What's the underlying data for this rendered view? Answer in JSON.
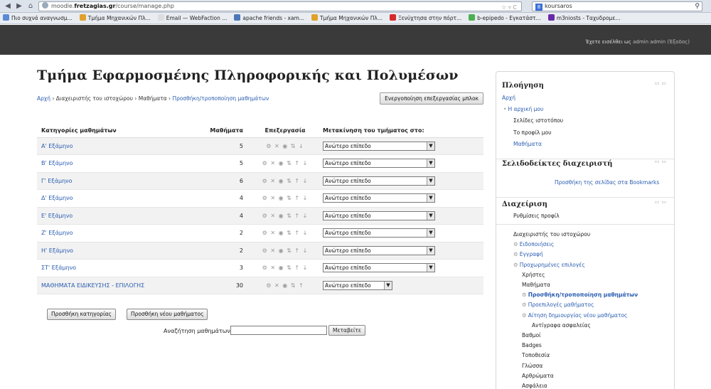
{
  "browser": {
    "url_host": "moodle.",
    "url_host_bold": "fretzagias.gr",
    "url_path": "/course/manage.php",
    "url_right": "☆ ▿ C",
    "search_value": "koursaros",
    "bookmarks": [
      {
        "label": "Πιο συχνά αναγνωσμ...",
        "color": "#5b8ad6"
      },
      {
        "label": "Τμήμα Μηχανικών Πλ...",
        "color": "#e0a12b"
      },
      {
        "label": "Email — WebFaction ...",
        "color": "#dddddd"
      },
      {
        "label": "apache friends - xam...",
        "color": "#4c78b8"
      },
      {
        "label": "Τμήμα Μηχανικών Πλ...",
        "color": "#e0a12b"
      },
      {
        "label": "Ξενύχτησα στην πόρτ...",
        "color": "#d62a2a"
      },
      {
        "label": "b-epipedo - Εγκατάστ...",
        "color": "#4caf50"
      },
      {
        "label": "m3niosts - Ταχυδρομε...",
        "color": "#6a2aa8"
      }
    ]
  },
  "header": {
    "login_prefix": "Έχετε εισέλθει ως",
    "login_user": "admin admin",
    "logout": "(Έξοδος)"
  },
  "page": {
    "title": "Τμήμα Εφαρμοσμένης Πληροφορικής και Πολυμέσων",
    "breadcrumb": [
      {
        "label": "Αρχή",
        "link": true
      },
      {
        "label": "Διαχειριστής του ιστοχώρου",
        "link": false
      },
      {
        "label": "Μαθήματα",
        "link": false
      },
      {
        "label": "Προσθήκη/τροποποίηση μαθημάτων",
        "link": true
      }
    ],
    "block_edit_button": "Ενεργοποίηση επεξεργασίας μπλοκ"
  },
  "table": {
    "headers": [
      "Κατηγορίες μαθημάτων",
      "Μαθήματα",
      "Επεξεργασία",
      "Μετακίνηση του τμήματος στο:"
    ],
    "rows": [
      {
        "name": "Α' Εξάμηνο",
        "count": "5",
        "actions": "⚙ ✕ ◉ ⇅ ↓",
        "move": "Ανώτερο επίπεδο"
      },
      {
        "name": "Β' Εξάμηνο",
        "count": "5",
        "actions": "⚙ ✕ ◉ ⇅ ↑ ↓",
        "move": "Ανώτερο επίπεδο"
      },
      {
        "name": "Γ' Εξάμηνο",
        "count": "6",
        "actions": "⚙ ✕ ◉ ⇅ ↑ ↓",
        "move": "Ανώτερο επίπεδο"
      },
      {
        "name": "Δ' Εξάμηνο",
        "count": "4",
        "actions": "⚙ ✕ ◉ ⇅ ↑ ↓",
        "move": "Ανώτερο επίπεδο"
      },
      {
        "name": "Ε' Εξάμηνο",
        "count": "4",
        "actions": "⚙ ✕ ◉ ⇅ ↑ ↓",
        "move": "Ανώτερο επίπεδο"
      },
      {
        "name": "Ζ' Εξάμηνο",
        "count": "2",
        "actions": "⚙ ✕ ◉ ⇅ ↑ ↓",
        "move": "Ανώτερο επίπεδο"
      },
      {
        "name": "Η' Εξάμηνο",
        "count": "2",
        "actions": "⚙ ✕ ◉ ⇅ ↑ ↓",
        "move": "Ανώτερο επίπεδο"
      },
      {
        "name": "ΣΤ' Εξάμηνο",
        "count": "3",
        "actions": "⚙ ✕ ◉ ⇅ ↑ ↓",
        "move": "Ανώτερο επίπεδο"
      },
      {
        "name": "ΜΑΘΗΜΑΤΑ ΕΙΔΙΚΕΥΣΗΣ - ΕΠΙΛΟΓΗΣ",
        "count": "30",
        "actions": "⚙ ✕ ◉ ⇅ ↑",
        "move": "Ανώτερο επίπεδο"
      }
    ]
  },
  "actions": {
    "add_category": "Προσθήκη κατηγορίας",
    "add_course": "Προσθήκη νέου μαθήματος",
    "search_label": "Αναζήτηση μαθημάτων:",
    "search_go": "Μεταβείτε"
  },
  "sidebar": {
    "navigation": {
      "title": "Πλοήγηση",
      "items": [
        "Αρχή",
        "Η αρχική μου",
        "Σελίδες ιστοτόπου",
        "Το προφίλ μου",
        "Μαθήματα"
      ]
    },
    "bookmarks": {
      "title": "Σελιδοδείκτες διαχειριστή",
      "add_link": "Προσθήκη της σελίδας στα Bookmarks"
    },
    "admin": {
      "title": "Διαχείριση",
      "profile": "Ρυθμίσεις προφίλ",
      "items": [
        "Διαχειριστής του ιστοχώρου",
        "Ειδοποιήσεις",
        "Εγγραφή",
        "Προχωρημένες επιλογές",
        "Χρήστες",
        "Μαθήματα",
        "Προσθήκη/τροποποίηση μαθημάτων",
        "Προεπιλογές μαθήματος",
        "Αίτηση δημιουργίας νέου μαθήματος",
        "Αντίγραφα ασφαλείας",
        "Βαθμοί",
        "Badges",
        "Τοποθεσία",
        "Γλώσσα",
        "Αρθρώματα",
        "Ασφάλεια"
      ]
    }
  }
}
